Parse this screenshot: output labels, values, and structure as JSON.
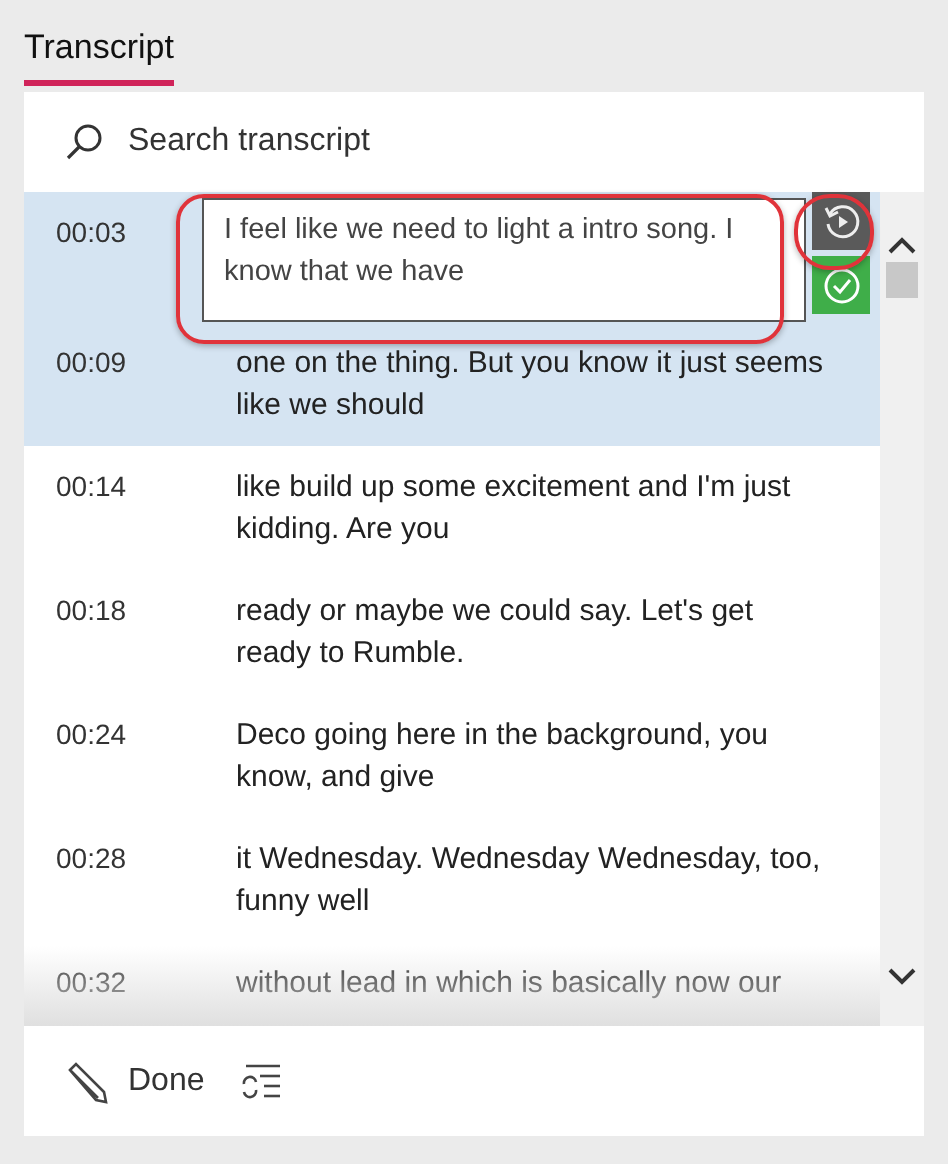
{
  "tabs": [
    {
      "label": "Transcript",
      "selected": true
    }
  ],
  "search": {
    "placeholder": "Search transcript"
  },
  "rows": [
    {
      "kind": "editing",
      "time": "00:03",
      "text": "I feel like we need to light a intro song. I know that we have",
      "selected": true
    },
    {
      "kind": "line",
      "time": "00:09",
      "text": "one on the thing. But you know it just seems like we should",
      "selected": true
    },
    {
      "kind": "line",
      "time": "00:14",
      "text": "like build up some excitement and I'm just kidding. Are you",
      "selected": false
    },
    {
      "kind": "line",
      "time": "00:18",
      "text": "ready or maybe we could say. Let's get ready to Rumble.",
      "selected": false
    },
    {
      "kind": "line",
      "time": "00:24",
      "text": "Deco going here in the background, you know, and give",
      "selected": false
    },
    {
      "kind": "line",
      "time": "00:28",
      "text": "it Wednesday. Wednesday Wednesday, too, funny well",
      "selected": false
    },
    {
      "kind": "line",
      "time": "00:32",
      "text": "without lead in which is basically now our",
      "selected": false
    }
  ],
  "footer": {
    "done_label": "Done"
  }
}
